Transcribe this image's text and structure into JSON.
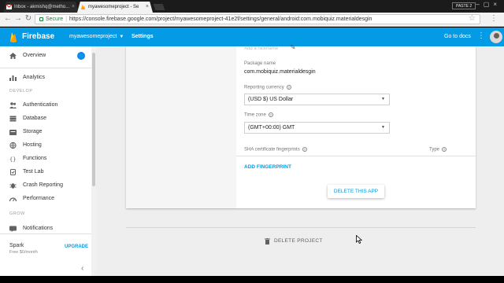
{
  "browser": {
    "tabs": [
      {
        "title": "Inbox - akmishq@metho...",
        "active": false
      },
      {
        "title": "myawesomeproject - Se",
        "active": true
      }
    ],
    "window_badge": "PASTE 2",
    "address": {
      "secure_label": "Secure",
      "url": "https://console.firebase.google.com/project/myawesomeproject-41e2f/settings/general/android:com.mobiquiz.materialdesgin"
    }
  },
  "header": {
    "brand": "Firebase",
    "project": "myawesomeproject",
    "page": "Settings",
    "docs_link": "Go to docs",
    "accent_color": "#039be5"
  },
  "sidebar": {
    "overview": "Overview",
    "analytics": "Analytics",
    "develop_section": "DEVELOP",
    "develop_items": [
      "Authentication",
      "Database",
      "Storage",
      "Hosting",
      "Functions",
      "Test Lab",
      "Crash Reporting",
      "Performance"
    ],
    "grow_section": "GROW",
    "grow_items": [
      "Notifications"
    ],
    "plan": {
      "name": "Spark",
      "price": "Free $0/month",
      "upgrade": "UPGRADE"
    }
  },
  "app_settings": {
    "nickname_placeholder": "Add a nickname",
    "package_name_label": "Package name",
    "package_name": "com.mobiquiz.materialdesgin",
    "currency_label": "Reporting currency",
    "currency_value": "(USD $) US Dollar",
    "timezone_label": "Time zone",
    "timezone_value": "(GMT+00:00) GMT",
    "fingerprints_label": "SHA certificate fingerprints",
    "type_label": "Type",
    "add_fingerprint": "ADD FINGERPRINT",
    "delete_app": "DELETE THIS APP"
  },
  "project_actions": {
    "delete_project": "DELETE PROJECT"
  }
}
